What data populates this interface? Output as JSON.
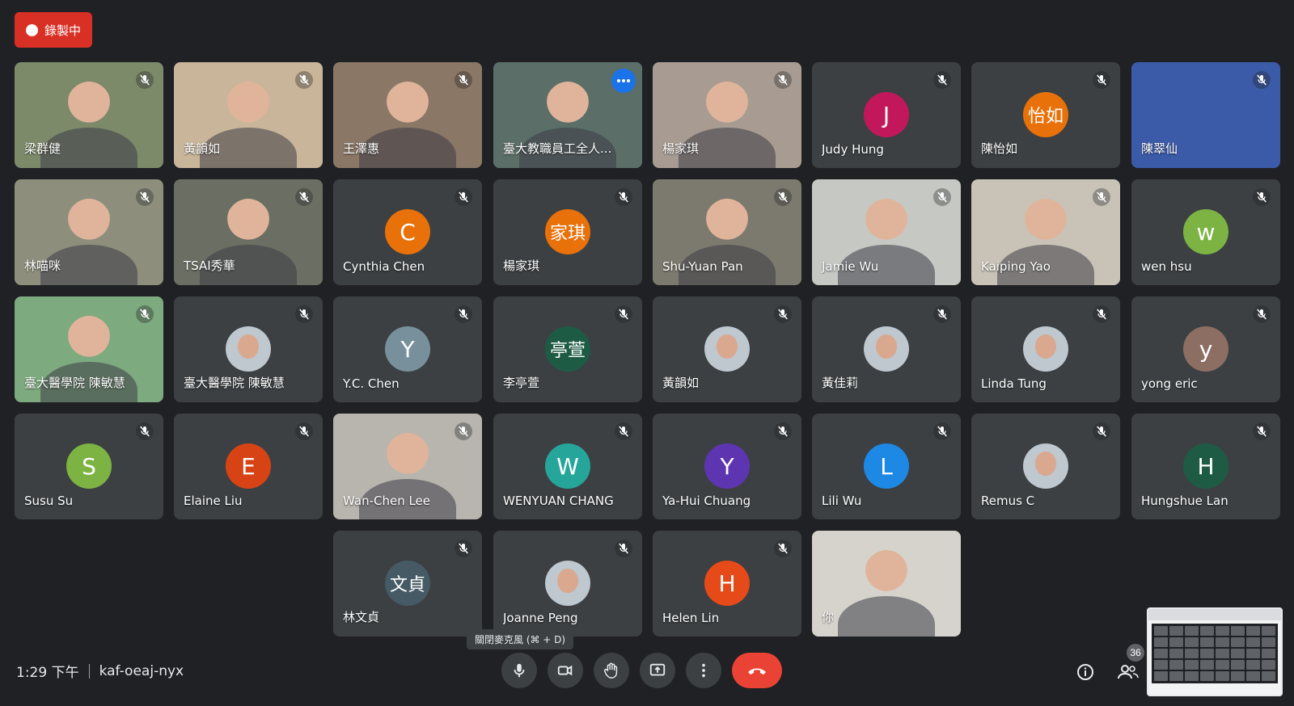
{
  "recording": {
    "label": "錄製中"
  },
  "participants": [
    {
      "name": "梁群健",
      "kind": "video",
      "bg": "#7d8a6a"
    },
    {
      "name": "黃韻如",
      "kind": "video",
      "bg": "#c9b59a"
    },
    {
      "name": "王澤惠",
      "kind": "video",
      "bg": "#8a7766"
    },
    {
      "name": "臺大教職員工全人...",
      "kind": "video",
      "bg": "#5b6e68",
      "active": true
    },
    {
      "name": "楊家琪",
      "kind": "video",
      "bg": "#a89c92"
    },
    {
      "name": "Judy Hung",
      "kind": "avatar",
      "initial": "J",
      "color": "#c2185b"
    },
    {
      "name": "陳怡如",
      "kind": "avatar",
      "initial": "怡如",
      "color": "#e8710a",
      "cjk": true
    },
    {
      "name": "陳翠仙",
      "kind": "image",
      "bg": "#3b5aa8"
    },
    {
      "name": "林喵咪",
      "kind": "video",
      "bg": "#8d8f7c"
    },
    {
      "name": "TSAI秀華",
      "kind": "video",
      "bg": "#6b6f63"
    },
    {
      "name": "Cynthia Chen",
      "kind": "avatar",
      "initial": "C",
      "color": "#e8710a"
    },
    {
      "name": "楊家琪",
      "kind": "avatar",
      "initial": "家琪",
      "color": "#e8710a",
      "cjk": true
    },
    {
      "name": "Shu-Yuan Pan",
      "kind": "video",
      "bg": "#7c7a6e"
    },
    {
      "name": "Jamie Wu",
      "kind": "video",
      "bg": "#c6c8c4"
    },
    {
      "name": "Kaiping Yao",
      "kind": "video",
      "bg": "#c9c3b7"
    },
    {
      "name": "wen hsu",
      "kind": "avatar",
      "initial": "w",
      "color": "#7cb342"
    },
    {
      "name": "臺大醫學院 陳敏慧",
      "kind": "video",
      "bg": "#7eaa7f"
    },
    {
      "name": "臺大醫學院 陳敏慧",
      "kind": "avatar-photo"
    },
    {
      "name": "Y.C. Chen",
      "kind": "avatar",
      "initial": "Y",
      "color": "#78909c"
    },
    {
      "name": "李亭萱",
      "kind": "avatar",
      "initial": "亭萱",
      "color": "#1e5b45",
      "cjk": true
    },
    {
      "name": "黃韻如",
      "kind": "avatar-photo"
    },
    {
      "name": "黃佳莉",
      "kind": "avatar-photo"
    },
    {
      "name": "Linda Tung",
      "kind": "avatar-photo"
    },
    {
      "name": "yong eric",
      "kind": "avatar",
      "initial": "y",
      "color": "#8d6e63"
    },
    {
      "name": "Susu Su",
      "kind": "avatar",
      "initial": "S",
      "color": "#7cb342"
    },
    {
      "name": "Elaine Liu",
      "kind": "avatar",
      "initial": "E",
      "color": "#d84315"
    },
    {
      "name": "Wan-Chen Lee",
      "kind": "video",
      "bg": "#b8b4ae"
    },
    {
      "name": "WENYUAN CHANG",
      "kind": "avatar",
      "initial": "W",
      "color": "#26a69a"
    },
    {
      "name": "Ya-Hui Chuang",
      "kind": "avatar",
      "initial": "Y",
      "color": "#5e35b1"
    },
    {
      "name": "Lili Wu",
      "kind": "avatar",
      "initial": "L",
      "color": "#1e88e5"
    },
    {
      "name": "Remus C",
      "kind": "avatar-photo"
    },
    {
      "name": "Hungshue Lan",
      "kind": "avatar",
      "initial": "H",
      "color": "#1e5b45"
    },
    {
      "name": "林文貞",
      "kind": "avatar",
      "initial": "文貞",
      "color": "#455a64",
      "cjk": true
    },
    {
      "name": "Joanne Peng",
      "kind": "avatar-photo"
    },
    {
      "name": "Helen Lin",
      "kind": "avatar",
      "initial": "H",
      "color": "#e64a19"
    },
    {
      "name": "你",
      "kind": "video",
      "bg": "#d6d2cc",
      "self": true
    }
  ],
  "tooltip": {
    "text": "關閉麥克風 (⌘ + D)"
  },
  "footer": {
    "time": "1:29 下午",
    "meeting_code": "kaf-oeaj-nyx"
  },
  "people_count": "36",
  "controls": [
    "mic-icon",
    "camera-icon",
    "raise-hand-icon",
    "present-icon",
    "more-icon",
    "hangup-icon"
  ],
  "colors": {
    "background": "#202124",
    "tile": "#3c4043",
    "accent": "#8ab4f8",
    "hangup": "#ea4335",
    "recording": "#d93025"
  }
}
